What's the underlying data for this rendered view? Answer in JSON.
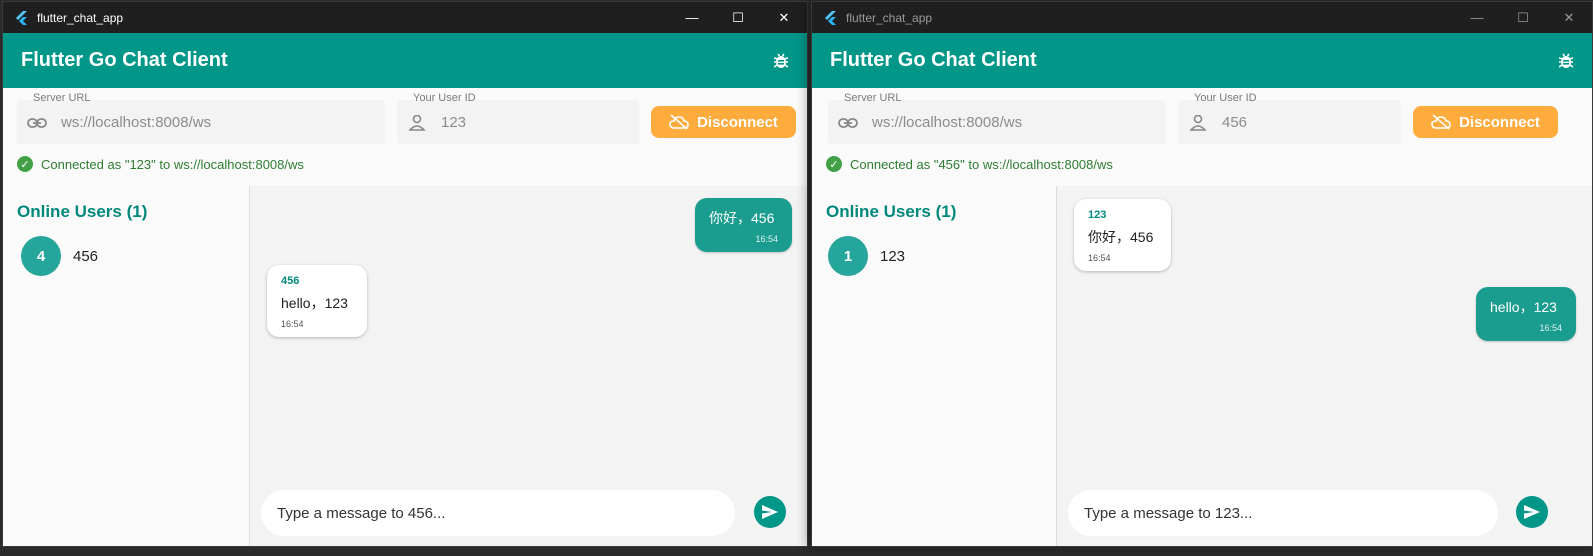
{
  "windows": [
    {
      "title": "flutter_chat_app",
      "app_title": "Flutter Go Chat Client",
      "server_url_label": "Server URL",
      "server_url_value": "ws://localhost:8008/ws",
      "user_id_label": "Your User ID",
      "user_id_value": "123",
      "disconnect_label": "Disconnect",
      "status_text": "Connected as \"123\" to ws://localhost:8008/ws",
      "online_header": "Online Users (1)",
      "users": [
        {
          "initial": "4",
          "name": "456"
        }
      ],
      "messages": [
        {
          "direction": "out",
          "text": "你好，456",
          "time": "16:54"
        },
        {
          "direction": "in",
          "sender": "456",
          "text": "hello，123",
          "time": "16:54"
        }
      ],
      "composer_placeholder": "Type a message to 456..."
    },
    {
      "title": "flutter_chat_app",
      "app_title": "Flutter Go Chat Client",
      "server_url_label": "Server URL",
      "server_url_value": "ws://localhost:8008/ws",
      "user_id_label": "Your User ID",
      "user_id_value": "456",
      "disconnect_label": "Disconnect",
      "status_text": "Connected as \"456\" to ws://localhost:8008/ws",
      "online_header": "Online Users (1)",
      "users": [
        {
          "initial": "1",
          "name": "123"
        }
      ],
      "messages": [
        {
          "direction": "in",
          "sender": "123",
          "text": "你好，456",
          "time": "16:54"
        },
        {
          "direction": "out",
          "text": "hello，123",
          "time": "16:54"
        }
      ],
      "composer_placeholder": "Type a message to 123..."
    }
  ],
  "colors": {
    "app_bar": "#009688",
    "disconnect": "#ffac3e",
    "status_green": "#2e7d32",
    "bubble_out": "#1a9c8e"
  },
  "icons": [
    "flutter-logo-icon",
    "minimize-icon",
    "maximize-icon",
    "close-icon",
    "bug-icon",
    "link-icon",
    "person-icon",
    "cloud-off-icon",
    "check-circle-icon",
    "send-icon"
  ]
}
